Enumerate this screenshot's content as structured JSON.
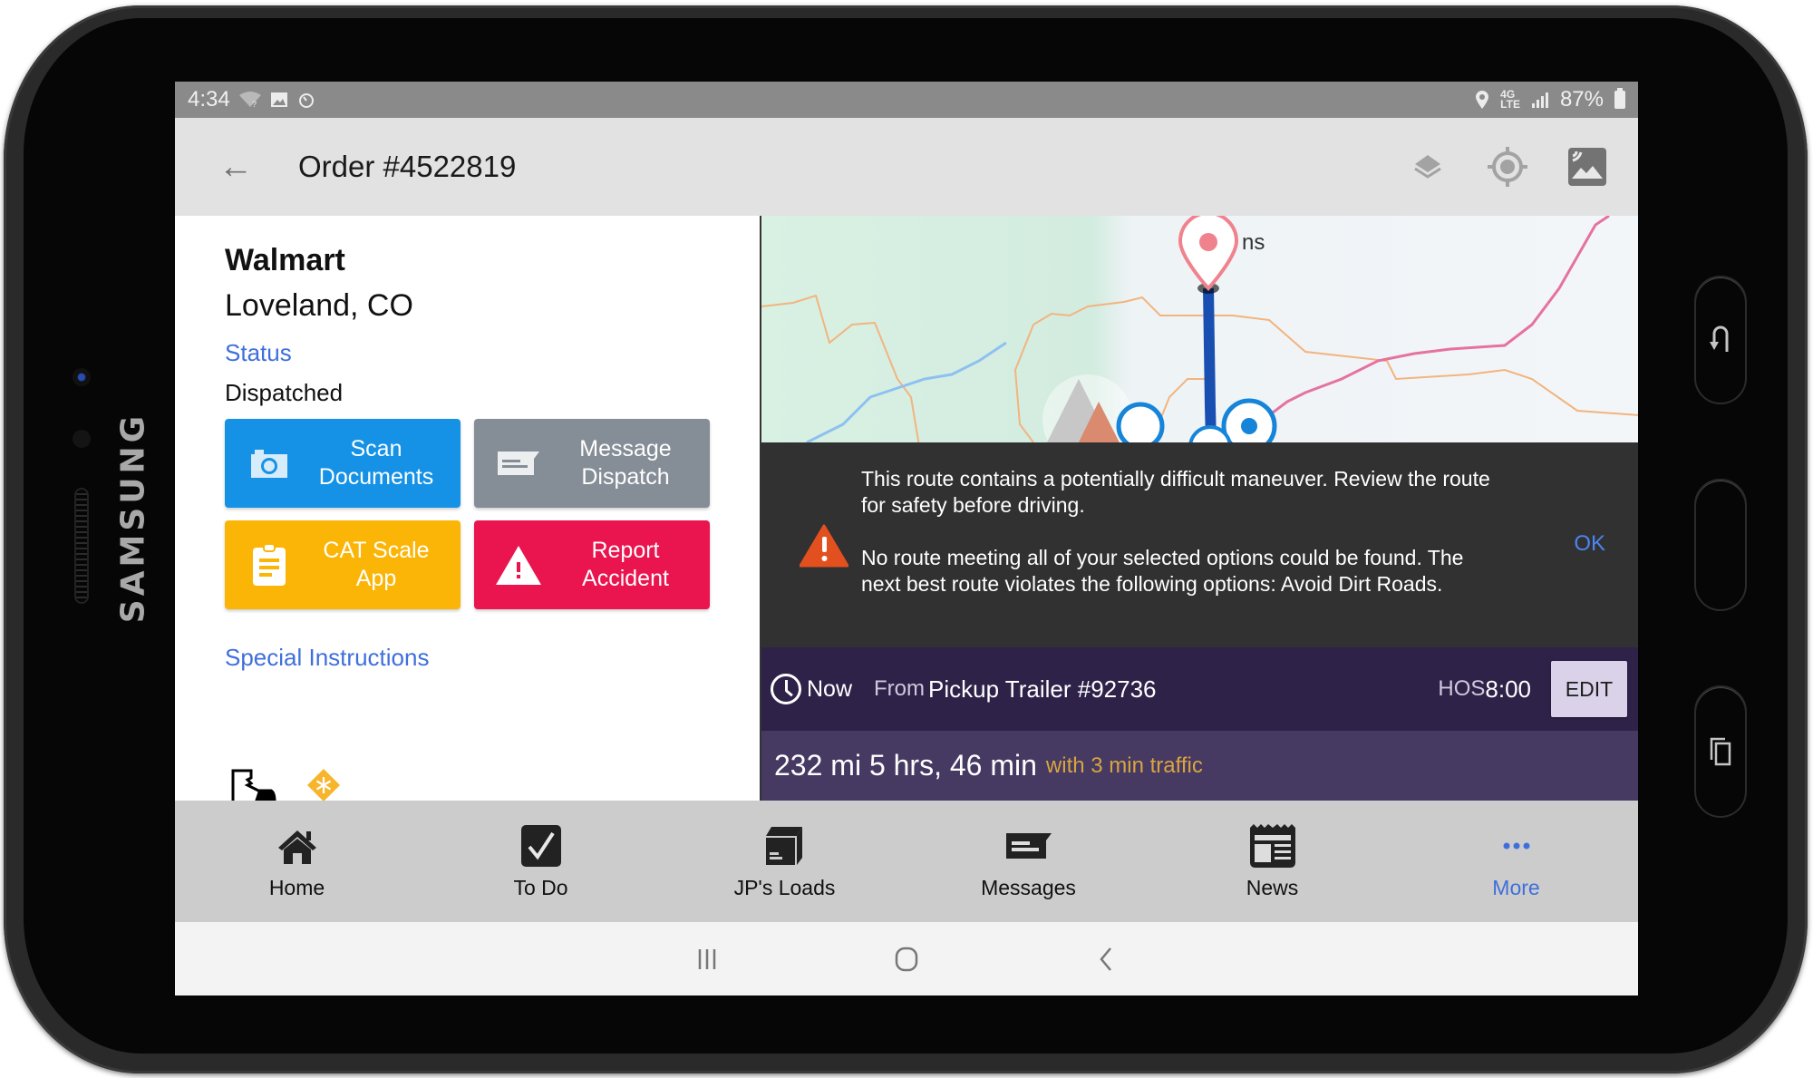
{
  "device": {
    "brand": "SAMSUNG",
    "hardware_buttons": [
      {
        "name": "back",
        "icon": "u-turn-back-icon"
      },
      {
        "name": "home",
        "icon": ""
      },
      {
        "name": "recent-apps",
        "icon": "recent-apps-icon"
      }
    ]
  },
  "status_bar": {
    "time": "4:34",
    "left_icons": [
      "wifi-unknown-icon",
      "image-icon",
      "timer-icon"
    ],
    "right_icons": [
      "location-icon",
      "4g-lte-icon",
      "signal-icon"
    ],
    "battery": "87%"
  },
  "header": {
    "title": "Order #4522819",
    "actions": [
      "layers-icon",
      "my-location-icon",
      "map-style-icon"
    ]
  },
  "order": {
    "name": "Walmart",
    "city": "Loveland, CO",
    "status_label": "Status",
    "status_value": "Dispatched",
    "buttons": [
      {
        "label": "Scan Documents",
        "color": "#1592e6",
        "icon": "camera-icon"
      },
      {
        "label": "Message Dispatch",
        "color": "#858d96",
        "icon": "message-icon"
      },
      {
        "label": "CAT Scale App",
        "color": "#fbb507",
        "icon": "clipboard-icon"
      },
      {
        "label": "Report Accident",
        "color": "#ea144e",
        "icon": "warning-icon"
      }
    ],
    "special_instructions": "Special Instructions",
    "load_icons": [
      "liftgate-icon",
      "refrigerated-icon"
    ]
  },
  "map": {
    "place_label_fragment": "ns",
    "alert": {
      "message_1": "This route contains a potentially difficult maneuver. Review the route for safety before driving.",
      "message_2": "No route meeting all of your selected options could be found. The next best route violates the following options: Avoid Dirt Roads.",
      "ok_label": "OK",
      "icon_color": "#e3501f"
    },
    "route": {
      "when": "Now",
      "from_label": "From",
      "from_value": "Pickup Trailer #92736",
      "hos_label": "HOS",
      "hos_value": "8:00",
      "edit_label": "EDIT",
      "summary": "232 mi 5 hrs, 46 min",
      "traffic": "with 3 min traffic"
    }
  },
  "bottom_nav": {
    "items": [
      {
        "label": "Home",
        "icon": "home-icon",
        "active": false
      },
      {
        "label": "To Do",
        "icon": "todo-check-icon",
        "active": false
      },
      {
        "label": "JP's Loads",
        "icon": "box-icon",
        "active": false
      },
      {
        "label": "Messages",
        "icon": "message-icon",
        "active": false
      },
      {
        "label": "News",
        "icon": "newspaper-icon",
        "active": false
      },
      {
        "label": "More",
        "icon": "more-dots-icon",
        "active": true
      }
    ],
    "accent": "#3f6fdc"
  },
  "system_nav": [
    "recents-button",
    "home-button",
    "back-button"
  ]
}
